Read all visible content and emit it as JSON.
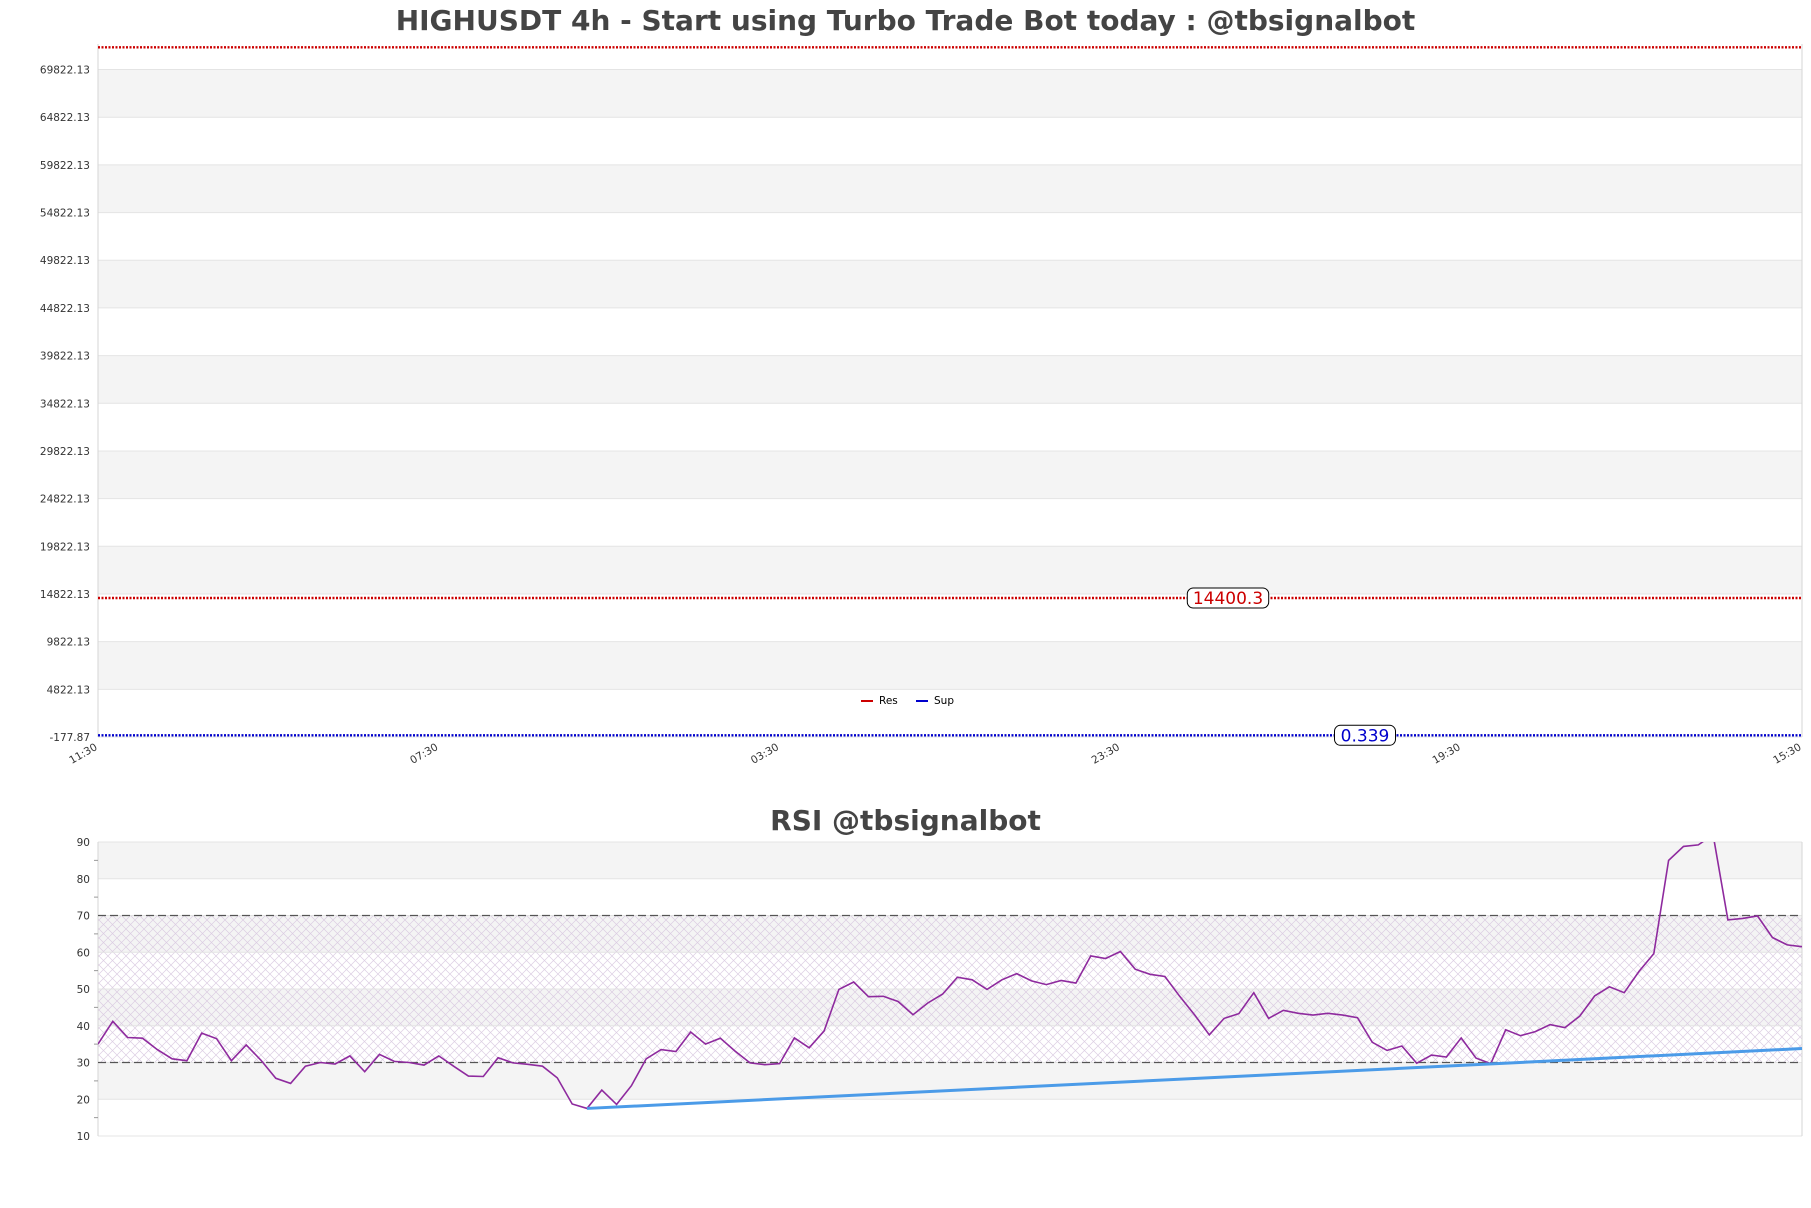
{
  "colors": {
    "background": "#ffffff",
    "band": "#f4f4f4",
    "grid": "#e4e4e4",
    "axis": "#d6d6d6",
    "title": "#444444",
    "resistance": "#cc0000",
    "support": "#0000cc",
    "rsi_line": "#8e2a9e",
    "trendline": "#4b9be8",
    "ref_dashed": "#555555",
    "hatch": "#d8c8e0"
  },
  "chart_data": [
    {
      "type": "line",
      "title": "HIGHUSDT 4h - Start using Turbo Trade Bot today : @tbsignalbot",
      "ylim": [
        -177.87,
        72500
      ],
      "y_ticks": [
        -177.87,
        4822.13,
        9822.13,
        14822.13,
        19822.13,
        24822.13,
        29822.13,
        34822.13,
        39822.13,
        44822.13,
        49822.13,
        54822.13,
        59822.13,
        64822.13,
        69822.13
      ],
      "y_tick_labels": [
        "-177.87",
        "4822.13",
        "9822.13",
        "14822.13",
        "19822.13",
        "24822.13",
        "29822.13",
        "34822.13",
        "39822.13",
        "44822.13",
        "49822.13",
        "54822.13",
        "59822.13",
        "64822.13",
        "69822.13"
      ],
      "x_tick_labels": [
        "11:30",
        "07:30",
        "03:30",
        "23:30",
        "19:30",
        "15:30"
      ],
      "grid": true,
      "legend": {
        "placement": "bottom-center",
        "entries": [
          "Res",
          "Sup"
        ]
      },
      "series": [
        {
          "name": "Res",
          "color": "#cc0000",
          "levels": [
            14400.3,
            72150
          ]
        },
        {
          "name": "Sup",
          "color": "#0000cc",
          "levels": [
            0.339
          ]
        }
      ],
      "annotations": [
        {
          "text": "14400.3",
          "value": 14400.3,
          "color": "#cc0000"
        },
        {
          "text": "0.339",
          "value": 0.339,
          "color": "#0000cc"
        }
      ]
    },
    {
      "type": "line",
      "title": "RSI @tbsignalbot",
      "ylim": [
        10,
        90
      ],
      "y_ticks": [
        10,
        20,
        30,
        40,
        50,
        60,
        70,
        80,
        90
      ],
      "y_tick_labels": [
        "10",
        "20",
        "30",
        "40",
        "50",
        "60",
        "70",
        "80",
        "90"
      ],
      "reference_lines": [
        30,
        70
      ],
      "grid": true,
      "series": [
        {
          "color": "#8e2a9e",
          "values": [
            35.0,
            41.2,
            36.8,
            36.6,
            33.5,
            31.0,
            30.5,
            38.0,
            36.5,
            30.5,
            34.8,
            30.6,
            25.7,
            24.3,
            29.0,
            30.0,
            29.6,
            31.8,
            27.5,
            32.2,
            30.3,
            30.0,
            29.3,
            31.8,
            29.0,
            26.3,
            26.2,
            31.3,
            29.9,
            29.5,
            29.0,
            25.8,
            18.7,
            17.5,
            22.5,
            18.6,
            23.7,
            31.0,
            33.5,
            33.0,
            38.3,
            35.0,
            36.6,
            33.1,
            29.9,
            29.4,
            29.7,
            36.7,
            34.0,
            38.6,
            49.9,
            51.9,
            47.9,
            48.0,
            46.6,
            43.0,
            46.2,
            48.6,
            53.2,
            52.5,
            49.9,
            52.5,
            54.2,
            52.2,
            51.2,
            52.3,
            51.6,
            59.0,
            58.3,
            60.2,
            55.4,
            54.0,
            53.4,
            48.0,
            43.0,
            37.5,
            42.0,
            43.3,
            49.0,
            42.0,
            44.2,
            43.4,
            42.9,
            43.4,
            42.9,
            42.2,
            35.5,
            33.3,
            34.5,
            29.8,
            32.0,
            31.5,
            36.7,
            31.2,
            29.7,
            38.9,
            37.3,
            38.4,
            40.3,
            39.5,
            42.6,
            48.1,
            50.6,
            49.0,
            54.8,
            59.6,
            85.0,
            88.8,
            89.2,
            92.0,
            68.8,
            69.2,
            69.9,
            64.0,
            62.0,
            61.5
          ]
        }
      ],
      "trendline": {
        "color": "#4b9be8",
        "from": {
          "index": 33,
          "value": 17.5
        },
        "to": {
          "index": 115,
          "value": 33.8
        }
      }
    }
  ]
}
